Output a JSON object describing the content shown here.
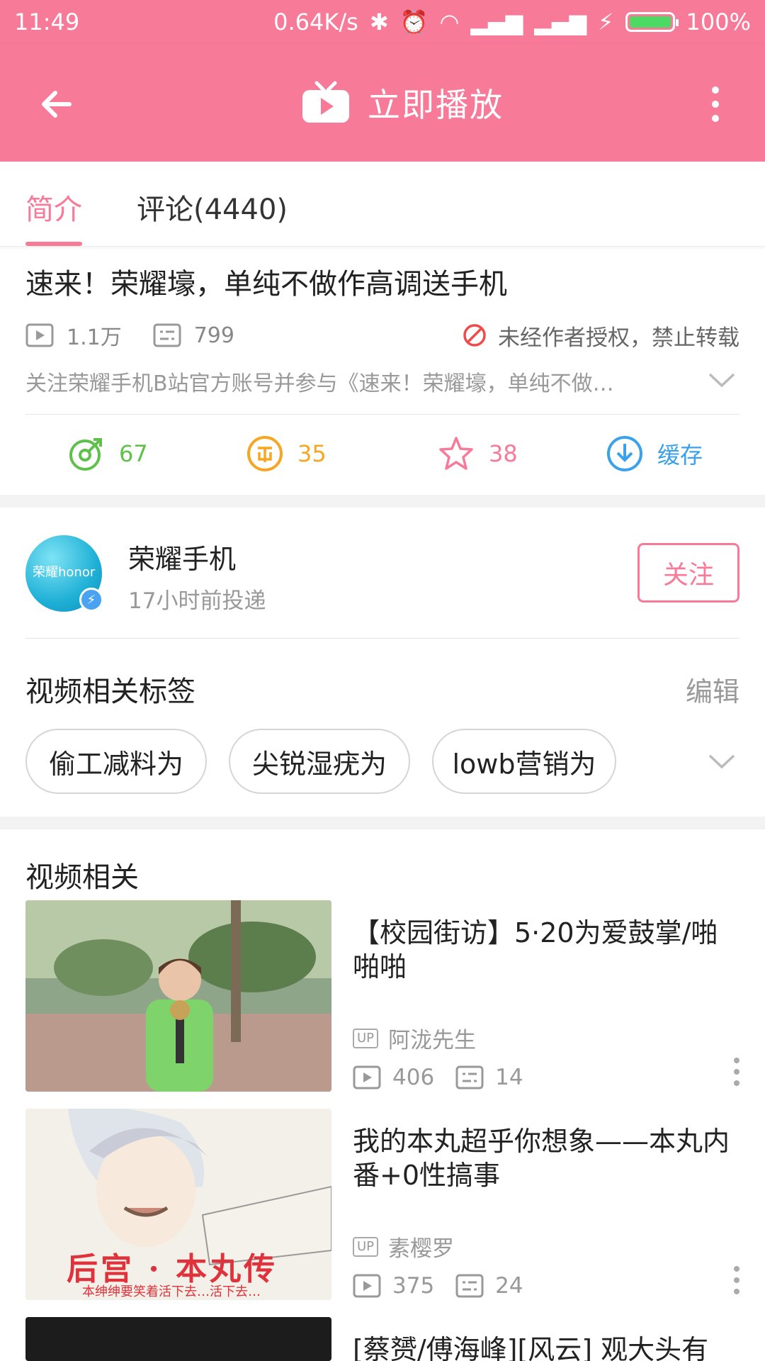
{
  "status_bar": {
    "time": "11:49",
    "speed": "0.64K/s",
    "battery": "100%",
    "battery_level": 1.0
  },
  "app_bar": {
    "title": "立即播放"
  },
  "tabs": [
    {
      "label": "简介",
      "active": true
    },
    {
      "label": "评论(4440)",
      "active": false
    }
  ],
  "video": {
    "title": "速来！荣耀壕，单纯不做作高调送手机",
    "plays": "1.1万",
    "danmaku": "799",
    "copyright_notice": "未经作者授权，禁止转载",
    "description": "关注荣耀手机B站官方账号并参与《速来！荣耀壕，单纯不做…"
  },
  "actions": [
    {
      "label": "67",
      "icon": "share-icon",
      "color": "#5fc14a"
    },
    {
      "label": "35",
      "icon": "coin-icon",
      "color": "#f5a623"
    },
    {
      "label": "38",
      "icon": "star-icon",
      "color": "#f87a99"
    },
    {
      "label": "缓存",
      "icon": "download-icon",
      "color": "#3aa1ea"
    }
  ],
  "uploader": {
    "name": "荣耀手机",
    "time": "17小时前投递",
    "avatar_text": "荣耀honor",
    "follow_label": "关注"
  },
  "tags": {
    "title": "视频相关标签",
    "edit_label": "编辑",
    "items": [
      "偷工减料为",
      "尖锐湿疣为",
      "lowb营销为"
    ]
  },
  "related": {
    "title": "视频相关",
    "items": [
      {
        "title": "【校园街访】5·20为爱鼓掌/啪啪啪",
        "up_badge": "UP",
        "uploader": "阿泷先生",
        "plays": "406",
        "danmaku": "14"
      },
      {
        "title": "我的本丸超乎你想象——本丸内番+0性搞事",
        "up_badge": "UP",
        "uploader": "素樱罗",
        "plays": "375",
        "danmaku": "24",
        "thumb_caption": "后宫 · 本丸传",
        "thumb_subcaption": "本绅绅要笑着活下去…活下去…"
      },
      {
        "title": "[蔡赟/傅海峰][风云] 观大头有约之柔的较真情"
      }
    ]
  },
  "colors": {
    "brand": "#f87a99",
    "divider": "#f3f3f3"
  }
}
